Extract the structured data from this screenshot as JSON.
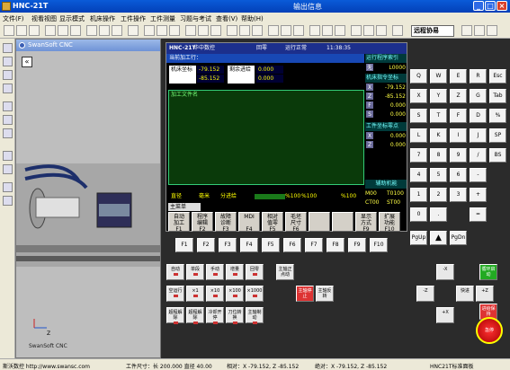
{
  "window": {
    "title": "HNC-21T",
    "output_info": "输出信息"
  },
  "menu": [
    "文件(F)",
    "视看视图",
    "显示模式",
    "机床操作",
    "工件操作",
    "工件测量",
    "习题与考试",
    "查看(V)",
    "帮助(H)"
  ],
  "toolbar": {
    "mode_select": "远程协易"
  },
  "sim": {
    "title": "SwanSoft CNC",
    "footer": "SwanSoft CNC",
    "z_axis": "Z"
  },
  "cnc": {
    "brand": "华中数控",
    "brand2": "世纪星",
    "model": "HNC-21T",
    "mode": "回零",
    "status": "运行正常",
    "time": "11:38:35",
    "current_program": "当前加工行：",
    "machine_coord_label": "机床坐标",
    "remaining_label": "剩余进给",
    "x_coord": "-79.152",
    "z_coord": "-85.152",
    "rem_x": "0.000",
    "rem_z": "0.000",
    "file_label": "加工文件名",
    "right_panel": {
      "index_label": "运行程序索引",
      "index_prefix": "无",
      "index_value": "L0000",
      "cmd_label": "机床指令坐标",
      "x": "-79.152",
      "z": "-85.152",
      "f": "0.000",
      "s": "0.000",
      "work_zero_label": "工件坐标零点",
      "wx": "0.000",
      "wz": "0.000",
      "aux_label": "辅助机能",
      "m": "M00",
      "t": "T0100",
      "ct": "CT00",
      "st": "ST00"
    },
    "statusline": {
      "diameter": "直径",
      "unit": "毫米",
      "feed": "分进给",
      "feed_pct": "%100",
      "rapid_pct": "%100",
      "spindle_pct": "%100"
    },
    "main_menu": "主菜单",
    "fkeys": [
      {
        "l1": "自动",
        "l2": "加工",
        "f": "F1"
      },
      {
        "l1": "程序",
        "l2": "编辑",
        "f": "F2"
      },
      {
        "l1": "故障",
        "l2": "诊断",
        "f": "F3"
      },
      {
        "l1": "MDI",
        "l2": "",
        "f": "F4"
      },
      {
        "l1": "相对",
        "l2": "值零",
        "f": "F5"
      },
      {
        "l1": "毛坯",
        "l2": "尺寸",
        "f": "F6"
      },
      {
        "l1": "",
        "l2": "",
        "f": ""
      },
      {
        "l1": "",
        "l2": "",
        "f": ""
      },
      {
        "l1": "显示",
        "l2": "方式",
        "f": "F9"
      },
      {
        "l1": "扩展",
        "l2": "功能",
        "f": "F10"
      }
    ],
    "keyboard": [
      [
        "Q",
        "W",
        "E",
        "R",
        "Esc"
      ],
      [
        "X",
        "Y",
        "Z",
        "G",
        "Tab"
      ],
      [
        "S",
        "T",
        "F",
        "D",
        "%"
      ],
      [
        "L",
        "K",
        "I",
        "J",
        "SP"
      ],
      [
        "7",
        "8",
        "9",
        "/",
        "BS"
      ],
      [
        "4",
        "5",
        "6",
        "-",
        ""
      ],
      [
        "1",
        "2",
        "3",
        "+",
        ""
      ],
      [
        "0",
        ".",
        "",
        "=",
        ""
      ]
    ],
    "nav_keys": [
      "PgUp",
      "PgDn",
      "Alt",
      "Upper",
      "Del",
      "Enter"
    ],
    "fbtns": [
      "F1",
      "F2",
      "F3",
      "F4",
      "F5",
      "F6",
      "F7",
      "F8",
      "F9",
      "F10"
    ],
    "ops": [
      [
        "自动",
        "单段",
        "手动",
        "增量",
        "回零"
      ],
      [
        "空运行",
        "×1",
        "×10",
        "×100",
        "×1000"
      ],
      [
        "超程解除",
        "超程解除",
        "冷却开停",
        "刀位转换",
        "主轴制动"
      ],
      [
        "主轴正点动",
        "主轴停止",
        "主轴反转",
        "快进",
        "-X"
      ],
      [
        "+Z",
        "-Z",
        "+X",
        "循环启动",
        "进给保持"
      ]
    ],
    "estop": "急停"
  },
  "statusbar": {
    "left": "斯沃数控 http://www.swansc.com",
    "size": "工件尺寸：长 200.000 直径 40.00",
    "rel": "相对：X -79.152, Z -85.152",
    "abs": "绝对：X -79.152, Z -85.152",
    "panel": "HNC21T标准面板"
  }
}
